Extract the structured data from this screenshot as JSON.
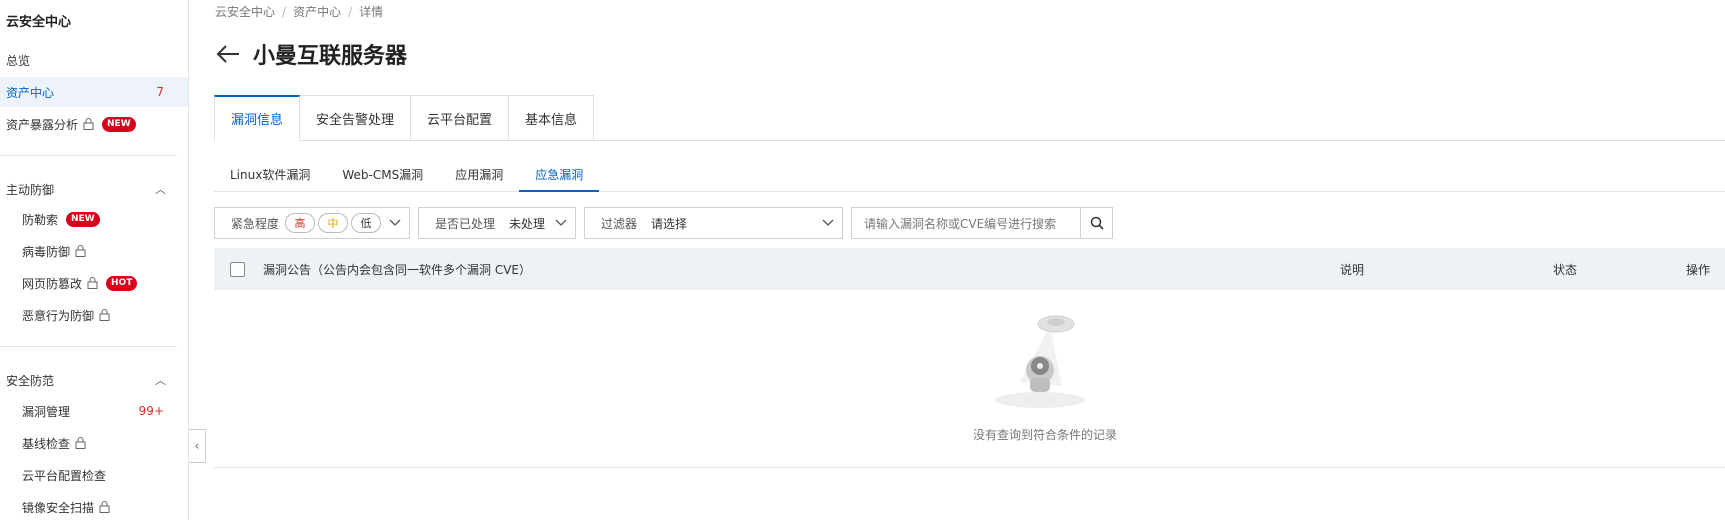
{
  "sidebar": {
    "brand": "云安全中心",
    "items": [
      {
        "label": "总览"
      },
      {
        "label": "资产中心",
        "count": "7"
      },
      {
        "label": "资产暴露分析",
        "badge": "NEW"
      }
    ],
    "group_active_defense": {
      "title": "主动防御",
      "items": [
        {
          "label": "防勒索",
          "badge": "NEW"
        },
        {
          "label": "病毒防御"
        },
        {
          "label": "网页防篡改",
          "badge": "HOT"
        },
        {
          "label": "恶意行为防御"
        }
      ]
    },
    "group_security": {
      "title": "安全防范",
      "items": [
        {
          "label": "漏洞管理",
          "count": "99+"
        },
        {
          "label": "基线检查"
        },
        {
          "label": "云平台配置检查"
        },
        {
          "label": "镜像安全扫描"
        }
      ]
    }
  },
  "breadcrumb": [
    "云安全中心",
    "资产中心",
    "详情"
  ],
  "page_title": "小曼互联服务器",
  "tabs": [
    "漏洞信息",
    "安全告警处理",
    "云平台配置",
    "基本信息"
  ],
  "subtabs": [
    "Linux软件漏洞",
    "Web-CMS漏洞",
    "应用漏洞",
    "应急漏洞"
  ],
  "filters": {
    "urgency_label": "紧急程度",
    "urgency_high": "高",
    "urgency_mid": "中",
    "urgency_low": "低",
    "handled_label": "是否已处理",
    "handled_value": "未处理",
    "filter_label": "过滤器",
    "filter_value": "请选择",
    "search_placeholder": "请输入漏洞名称或CVE编号进行搜索"
  },
  "table": {
    "col_announcement": "漏洞公告（公告内会包含同一软件多个漏洞 CVE）",
    "col_desc": "说明",
    "col_status": "状态",
    "col_action": "操作"
  },
  "empty_text": "没有查询到符合条件的记录",
  "colors": {
    "primary": "#0064c8",
    "danger": "#d93026",
    "badge": "#d9001b"
  }
}
